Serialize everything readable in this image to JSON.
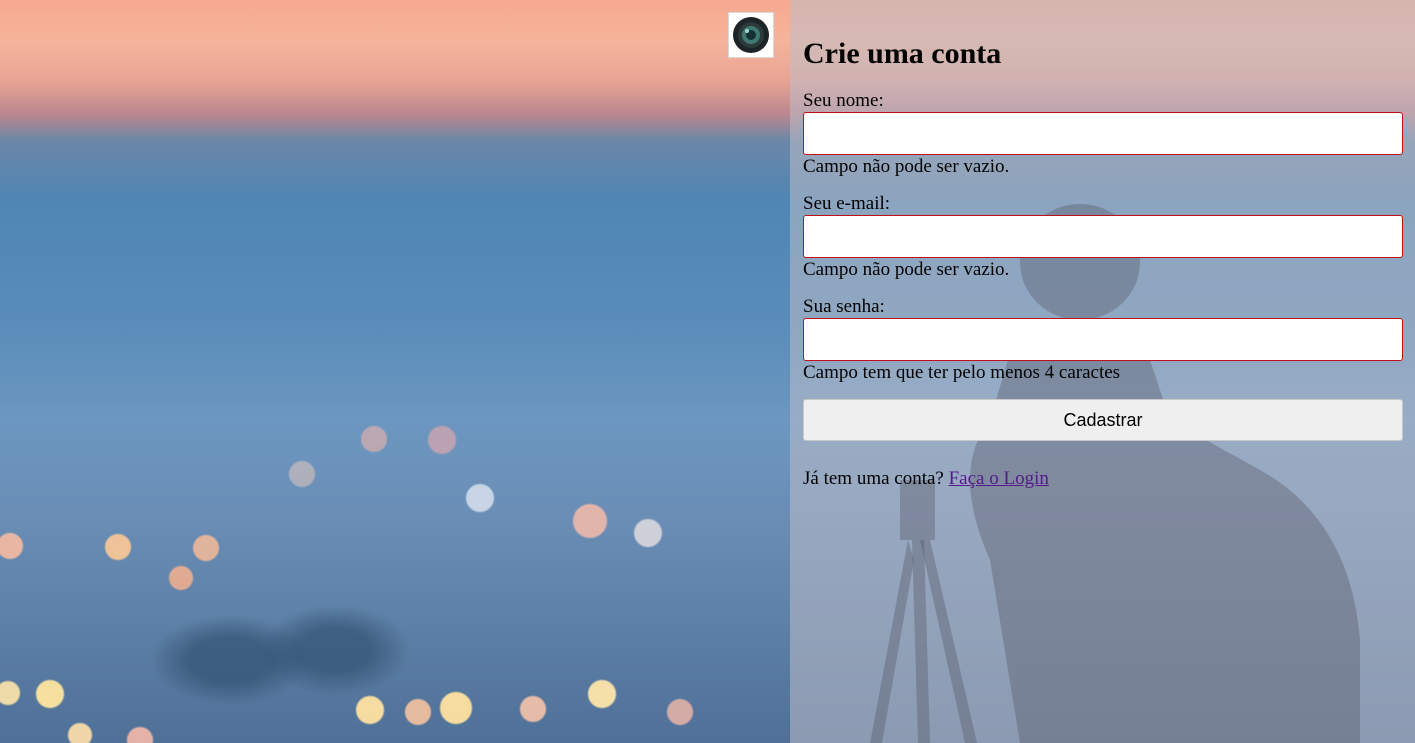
{
  "logo": {
    "icon": "camera-lens-icon"
  },
  "form": {
    "title": "Crie uma conta",
    "name_label": "Seu nome:",
    "name_value": "",
    "name_error": "Campo não pode ser vazio.",
    "email_label": "Seu e-mail:",
    "email_value": "",
    "email_error": "Campo não pode ser vazio.",
    "password_label": "Sua senha:",
    "password_value": "",
    "password_error": "Campo tem que ter pelo menos 4 caractes",
    "submit_label": "Cadastrar",
    "footer_text": "Já tem uma conta?",
    "login_link": "Faça o Login"
  },
  "colors": {
    "error_border": "#c0101a",
    "link": "#551a8b",
    "button_bg": "#efefef"
  }
}
